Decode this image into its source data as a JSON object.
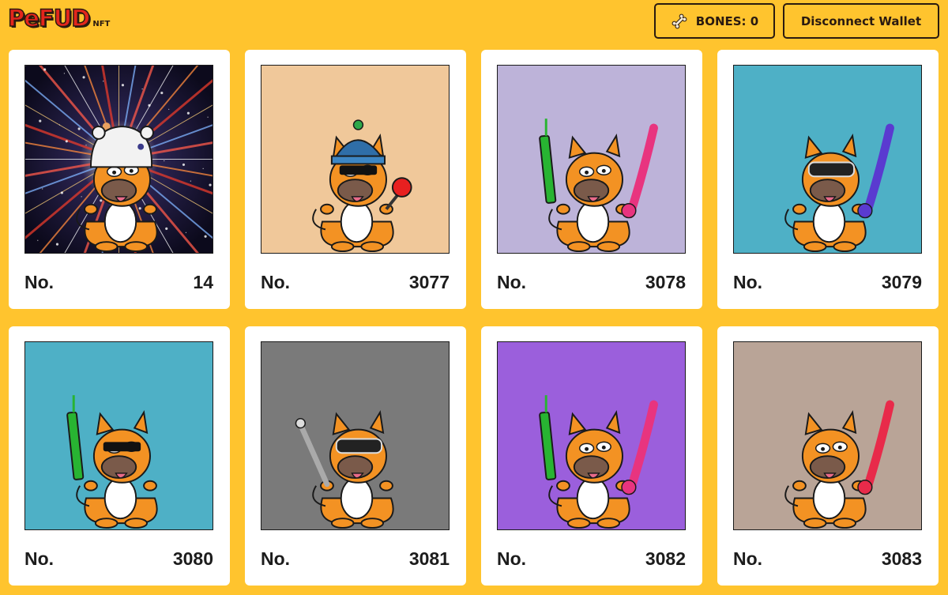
{
  "header": {
    "logo_text": "PeFUD",
    "logo_sub": "NFT",
    "bones_label": "BONES: 0",
    "bones_icon": "bone-icon",
    "disconnect_label": "Disconnect Wallet"
  },
  "colors": {
    "page_background": "#FFC42E",
    "card_background": "#FFFFFF",
    "text": "#1C1C1C",
    "logo_red": "#E3261C"
  },
  "nfts": [
    {
      "prefix": "No.",
      "number": "14",
      "bg": "#1b1530",
      "item": "space-polar-bear"
    },
    {
      "prefix": "No.",
      "number": "3077",
      "bg": "#F0C89A",
      "item": "beanie-sunglasses-paddle"
    },
    {
      "prefix": "No.",
      "number": "3078",
      "bg": "#BDB3D9",
      "item": "green-bat-pink-balloon"
    },
    {
      "prefix": "No.",
      "number": "3079",
      "bg": "#4EB0C6",
      "item": "vr-goggles-purple-balloon"
    },
    {
      "prefix": "No.",
      "number": "3080",
      "bg": "#4EB0C6",
      "item": "green-bat-sunglasses"
    },
    {
      "prefix": "No.",
      "number": "3081",
      "bg": "#7A7A7A",
      "item": "bat-vr-goggles"
    },
    {
      "prefix": "No.",
      "number": "3082",
      "bg": "#9B5FDC",
      "item": "green-bat-pink-balloon"
    },
    {
      "prefix": "No.",
      "number": "3083",
      "bg": "#B9A497",
      "item": "red-balloon"
    }
  ]
}
